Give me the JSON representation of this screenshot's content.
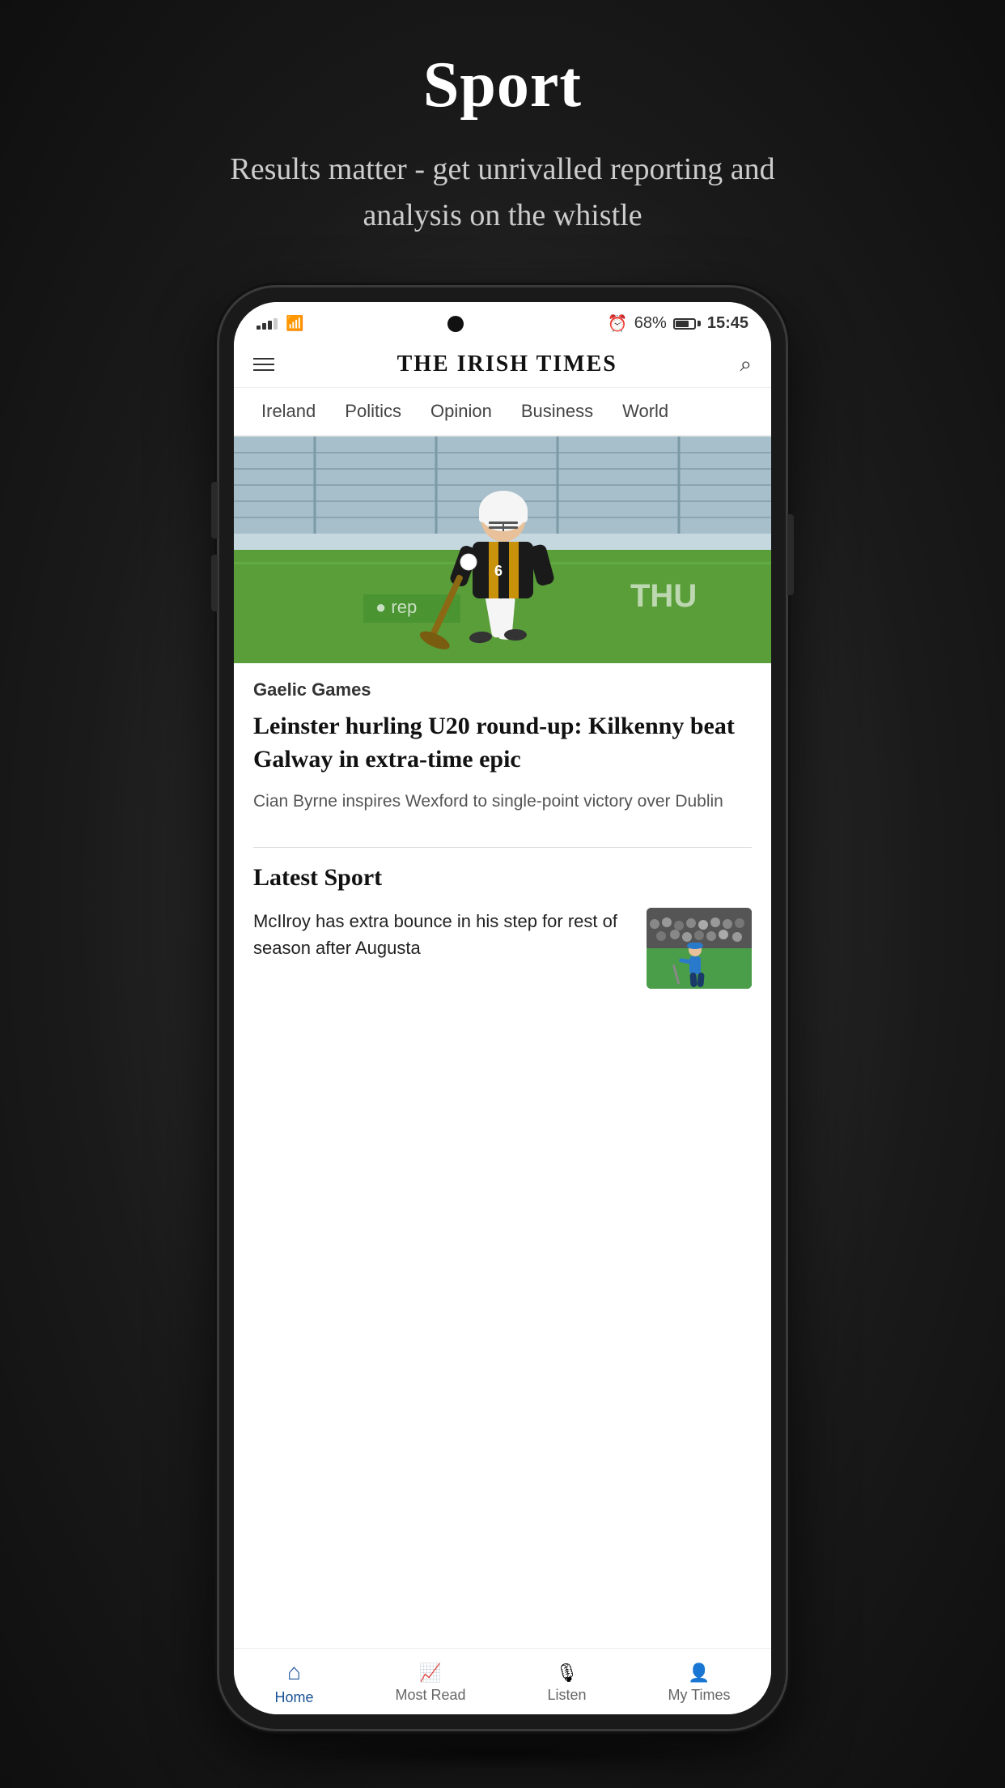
{
  "page": {
    "title": "Sport",
    "subtitle": "Results matter - get unrivalled reporting and analysis on the whistle"
  },
  "status_bar": {
    "time": "15:45",
    "battery": "68%",
    "signal_strength": "3"
  },
  "top_nav": {
    "newspaper_title": "THE IRISH TIMES",
    "menu_label": "Menu",
    "search_label": "Search"
  },
  "category_nav": {
    "items": [
      "Ireland",
      "Politics",
      "Opinion",
      "Business",
      "World"
    ]
  },
  "hero_article": {
    "category": "Gaelic Games",
    "title": "Leinster hurling U20 round-up: Kilkenny beat Galway in extra-time epic",
    "summary": "Cian Byrne inspires Wexford to single-point victory over Dublin"
  },
  "latest_sport": {
    "heading": "Latest Sport",
    "items": [
      {
        "text": "McIlroy has extra bounce in his step for rest of season after Augusta"
      }
    ]
  },
  "bottom_nav": {
    "items": [
      {
        "label": "Home",
        "active": true
      },
      {
        "label": "Most Read",
        "active": false
      },
      {
        "label": "Listen",
        "active": false
      },
      {
        "label": "My Times",
        "active": false
      }
    ]
  }
}
